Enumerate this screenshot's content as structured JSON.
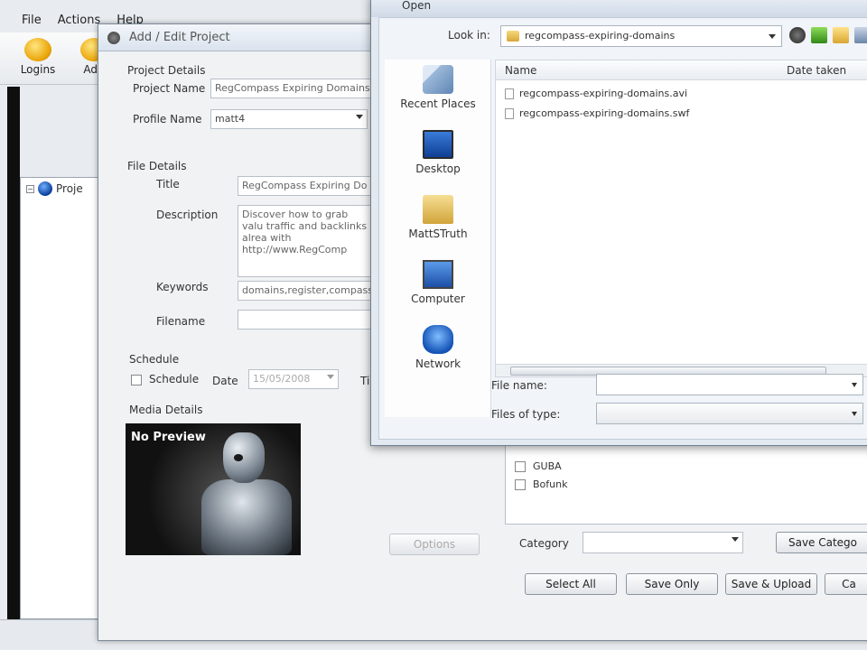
{
  "app": {
    "menu": [
      "File",
      "Actions",
      "Help"
    ],
    "toolbar": {
      "logins_label": "Logins",
      "add_label": "Add"
    },
    "tree_root_label": "Proje"
  },
  "edit_dialog": {
    "title": "Add / Edit Project",
    "project_details": {
      "group_label": "Project Details",
      "project_name_label": "Project Name",
      "project_name_value": "RegCompass Expiring Domains",
      "profile_name_label": "Profile Name",
      "profile_name_value": "matt4"
    },
    "file_details": {
      "group_label": "File Details",
      "title_label": "Title",
      "title_value": "RegCompass Expiring Do",
      "description_label": "Description",
      "description_value": "Discover how to grab valu traffic and backlinks alrea with http://www.RegComp",
      "keywords_label": "Keywords",
      "keywords_value": "domains,register,compass",
      "filename_label": "Filename",
      "filename_value": ""
    },
    "schedule": {
      "group_label": "Schedule",
      "checkbox_label": "Schedule",
      "date_label": "Date",
      "date_value": "15/05/2008",
      "time_label": "Ti"
    },
    "media_details": {
      "group_label": "Media Details",
      "preview_label": "No Preview",
      "options_button": "Options"
    },
    "categories": [
      "GUBA",
      "Bofunk"
    ],
    "category_label": "Category",
    "category_value": "",
    "save_category_button": "Save Catego",
    "buttons": {
      "select_all": "Select All",
      "save_only": "Save Only",
      "save_upload": "Save & Upload",
      "cancel": "Ca"
    }
  },
  "open_dialog": {
    "title": "Open",
    "look_in_label": "Look in:",
    "look_in_value": "regcompass-expiring-domains",
    "places": [
      "Recent Places",
      "Desktop",
      "MattSTruth",
      "Computer",
      "Network"
    ],
    "columns": {
      "name": "Name",
      "date_taken": "Date taken"
    },
    "files": [
      "regcompass-expiring-domains.avi",
      "regcompass-expiring-domains.swf"
    ],
    "file_name_label": "File name:",
    "file_name_value": "",
    "files_of_type_label": "Files of type:",
    "files_of_type_value": ""
  }
}
